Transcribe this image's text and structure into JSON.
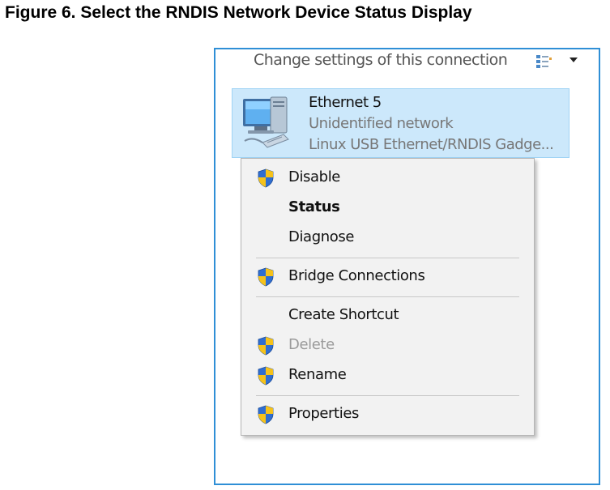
{
  "figure": {
    "caption": "Figure 6. Select the RNDIS Network Device Status Display"
  },
  "window": {
    "toolbar_text": "Change settings of this connection",
    "view_icon": "change-view-icon",
    "dropdown_icon": "chevron-down-icon"
  },
  "network_item": {
    "name": "Ethernet 5",
    "status": "Unidentified network",
    "device": "Linux USB Ethernet/RNDIS Gadge...",
    "icon": "network-adapter-icon",
    "selection_color": "#cce8fb"
  },
  "context_menu": {
    "items": [
      {
        "label": "Disable",
        "shield": true,
        "bold": false,
        "disabled": false
      },
      {
        "label": "Status",
        "shield": false,
        "bold": true,
        "disabled": false
      },
      {
        "label": "Diagnose",
        "shield": false,
        "bold": false,
        "disabled": false
      },
      {
        "label": "Bridge Connections",
        "shield": true,
        "bold": false,
        "disabled": false
      },
      {
        "label": "Create Shortcut",
        "shield": false,
        "bold": false,
        "disabled": false
      },
      {
        "label": "Delete",
        "shield": true,
        "bold": false,
        "disabled": true
      },
      {
        "label": "Rename",
        "shield": true,
        "bold": false,
        "disabled": false
      },
      {
        "label": "Properties",
        "shield": true,
        "bold": false,
        "disabled": false
      }
    ]
  },
  "colors": {
    "frame_border": "#2f8fd6",
    "shield_blue": "#2f6ed1",
    "shield_yellow": "#f6c21a"
  }
}
